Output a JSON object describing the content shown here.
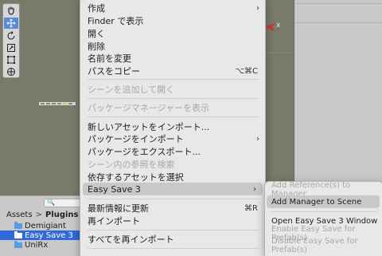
{
  "scene": {
    "gizmo_axis_label": "x"
  },
  "toolbar": {
    "tools": [
      {
        "icon": "hand-icon",
        "active": false
      },
      {
        "icon": "move-icon",
        "active": true
      },
      {
        "icon": "rotate-icon",
        "active": false
      },
      {
        "icon": "scale-icon",
        "active": false
      },
      {
        "icon": "rect-icon",
        "active": false
      },
      {
        "icon": "transform-icon",
        "active": false
      }
    ]
  },
  "project": {
    "search_icon": "🔍",
    "path": [
      "Assets",
      "Plugins"
    ],
    "path_separator": ">",
    "folders": [
      {
        "label": "Demigiant",
        "selected": false
      },
      {
        "label": "Easy Save 3",
        "selected": true
      },
      {
        "label": "UniRx",
        "selected": false
      }
    ]
  },
  "menu": {
    "items": [
      {
        "label": "作成",
        "arrow": "›"
      },
      {
        "label": "Finder で表示"
      },
      {
        "label": "開く"
      },
      {
        "label": "削除"
      },
      {
        "label": "名前を変更"
      },
      {
        "label": "パスをコピー",
        "shortcut": "⌥⌘C"
      },
      {
        "label": "シーンを追加して開く",
        "disabled": true
      },
      {
        "label": "パッケージマネージャーを表示",
        "disabled": true
      },
      {
        "label": "新しいアセットをインポート..."
      },
      {
        "label": "パッケージをインポート",
        "arrow": "›"
      },
      {
        "label": "パッケージをエクスポート..."
      },
      {
        "label": "シーン内の参照を検索",
        "disabled": true
      },
      {
        "label": "依存するアセットを選択"
      },
      {
        "label": "Easy Save 3",
        "arrow": "›",
        "highlighted": true
      },
      {
        "label": "最新情報に更新",
        "shortcut": "⌘R"
      },
      {
        "label": "再インポート"
      },
      {
        "label": "すべてを再インポート"
      }
    ]
  },
  "submenu": {
    "items": [
      {
        "label": "Add Reference(s) to Manager",
        "disabled": true
      },
      {
        "label": "Add Manager to Scene",
        "highlighted": true
      },
      {
        "label": "Open Easy Save 3 Window"
      },
      {
        "label": "Enable Easy Save for Prefab(s)",
        "disabled": true
      },
      {
        "label": "Disable Easy Save for Prefab(s)",
        "disabled": true
      }
    ]
  },
  "colors": {
    "scene_bg": "#7a7a6b",
    "selection_blue": "#2f6ad8",
    "menu_bg": "#e8e8e8",
    "gizmo_red": "#d9302a"
  }
}
